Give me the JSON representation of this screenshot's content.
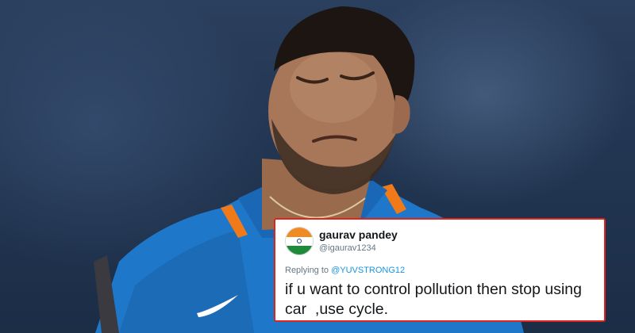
{
  "tweet": {
    "display_name": "gaurav pandey",
    "handle": "@igaurav1234",
    "replying_prefix": "Replying to ",
    "replying_to": "@YUVSTRONG12",
    "text": "if u want to control pollution then stop using car  ,use cycle.",
    "avatar": "india-flag-avatar",
    "border_color": "#e0241c",
    "link_color": "#1b95e0"
  },
  "photo": {
    "subject": "cricketer-in-blue-jersey",
    "jersey_color": "#1f77c9",
    "background_color": "#24344f"
  }
}
